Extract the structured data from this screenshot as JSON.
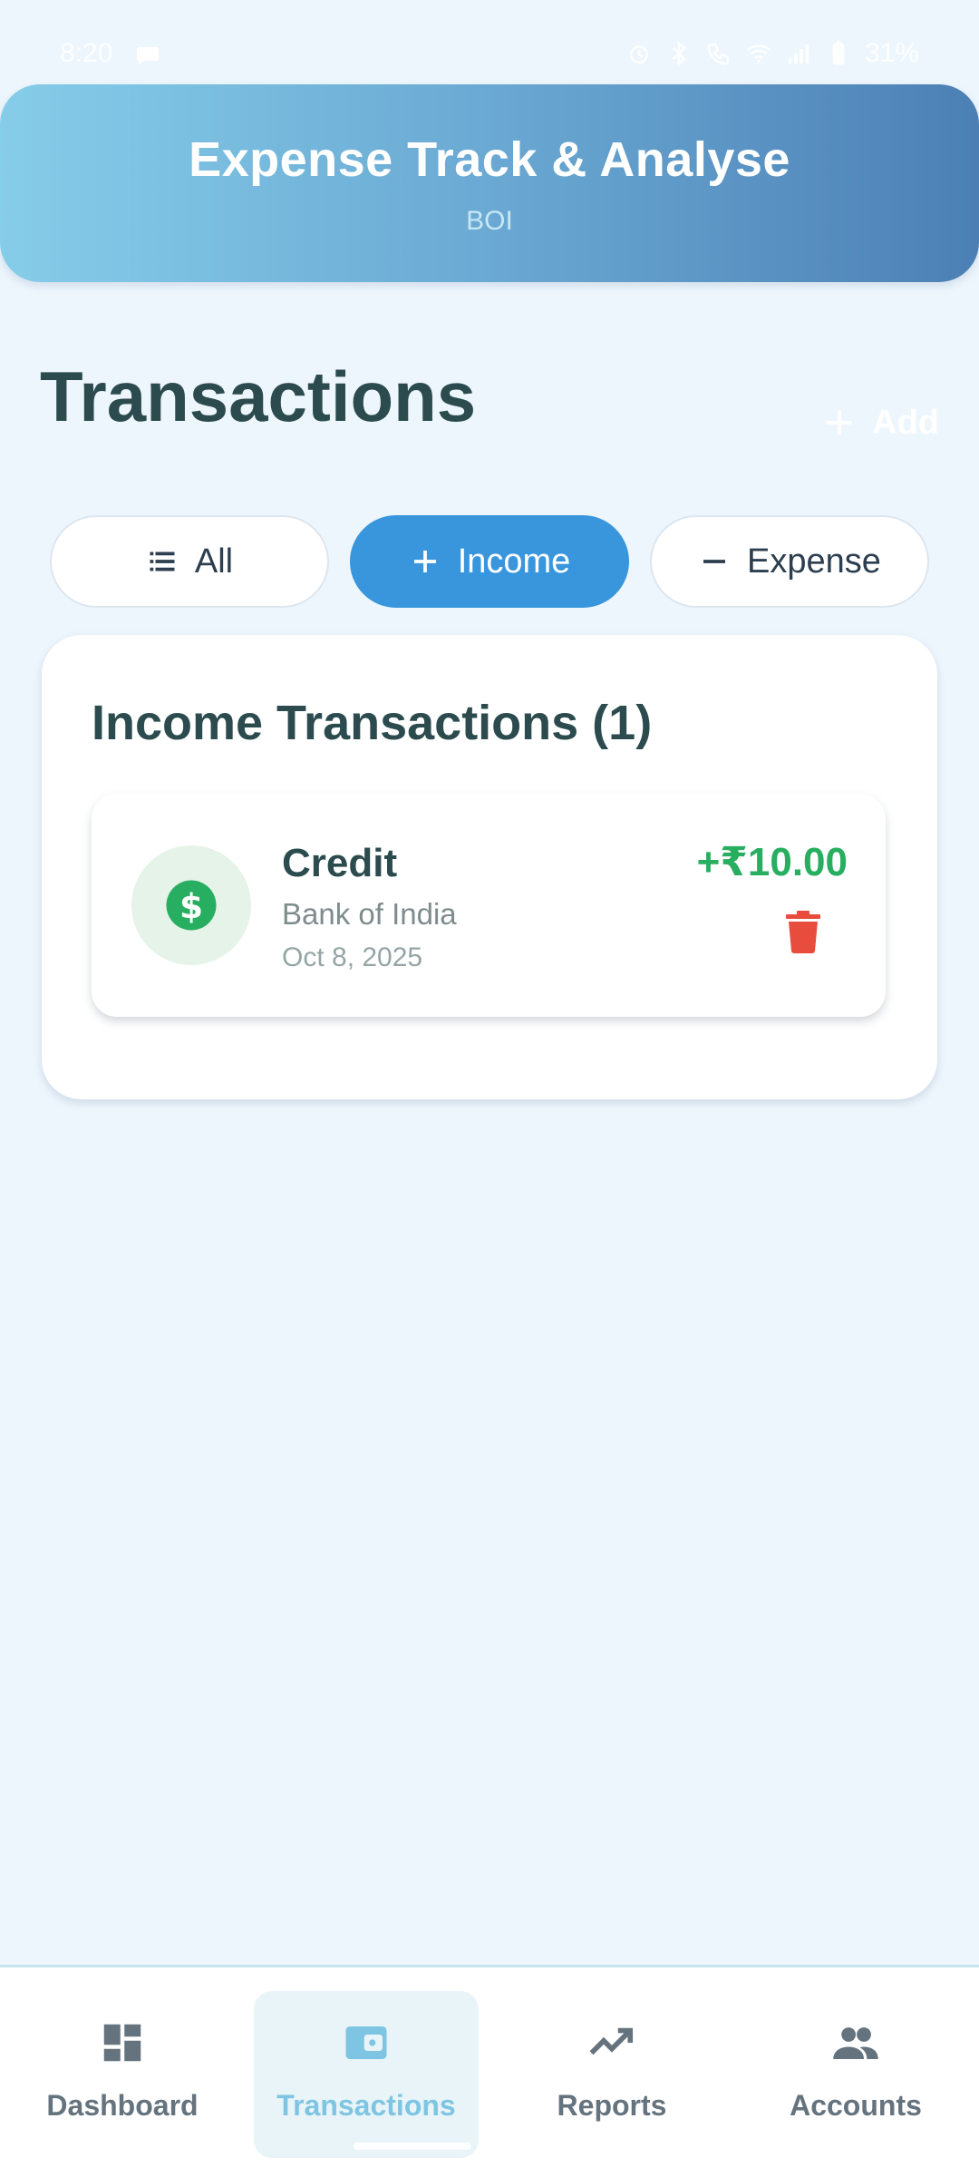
{
  "status": {
    "time": "8:20",
    "battery": "31%"
  },
  "header": {
    "title": "Expense Track & Analyse",
    "subtitle": "BOI"
  },
  "page": {
    "title": "Transactions",
    "add_label": "Add"
  },
  "filters": {
    "all_label": "All",
    "income_label": "Income",
    "expense_label": "Expense",
    "selected": "Income"
  },
  "card": {
    "title": "Income Transactions (1)"
  },
  "transactions": [
    {
      "name": "Credit",
      "bank": "Bank of India",
      "date": "Oct 8, 2025",
      "amount": "+₹10.00",
      "icon": "dollar-icon",
      "amount_color": "#27ae60"
    }
  ],
  "nav": {
    "items": [
      {
        "label": "Dashboard",
        "icon": "dashboard-icon"
      },
      {
        "label": "Transactions",
        "icon": "wallet-icon"
      },
      {
        "label": "Reports",
        "icon": "trending-up-icon"
      },
      {
        "label": "Accounts",
        "icon": "people-icon"
      }
    ],
    "active": "Transactions"
  },
  "colors": {
    "accent": "#3996dc",
    "income": "#27ae60",
    "delete": "#e74c3c",
    "nav_active": "#7ec5e3"
  }
}
